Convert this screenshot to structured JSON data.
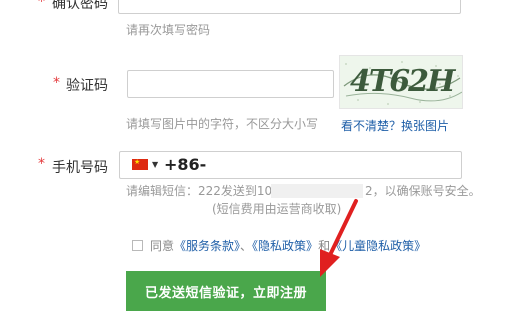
{
  "confirm_password": {
    "required_mark": "*",
    "label": "确认密码",
    "hint": "请再次填写密码"
  },
  "captcha": {
    "required_mark": "*",
    "label": "验证码",
    "input_value": "",
    "image_text": "4T62H",
    "hint": "请填写图片中的字符，不区分大小写",
    "refresh_link": "看不清楚？换张图片"
  },
  "phone": {
    "required_mark": "*",
    "label": "手机号码",
    "country_code": "+86-",
    "flag_icon": "china-flag-icon",
    "hint_line1_part1": "请编辑短信：222发送到106",
    "hint_line1_part2": "2，以确保账号安全。",
    "hint_line2": "(短信费用由运营商收取)"
  },
  "agreement": {
    "checked": false,
    "text_before": "同意",
    "terms_link": "《服务条款》",
    "separator": "、",
    "privacy_link": "《隐私政策》",
    "and": "和",
    "child_privacy_link": "《儿童隐私政策》"
  },
  "submit_button": {
    "label": "已发送短信验证，立即注册",
    "color": "#4aa74b"
  },
  "annotation_arrow": {
    "color": "#e02020"
  }
}
